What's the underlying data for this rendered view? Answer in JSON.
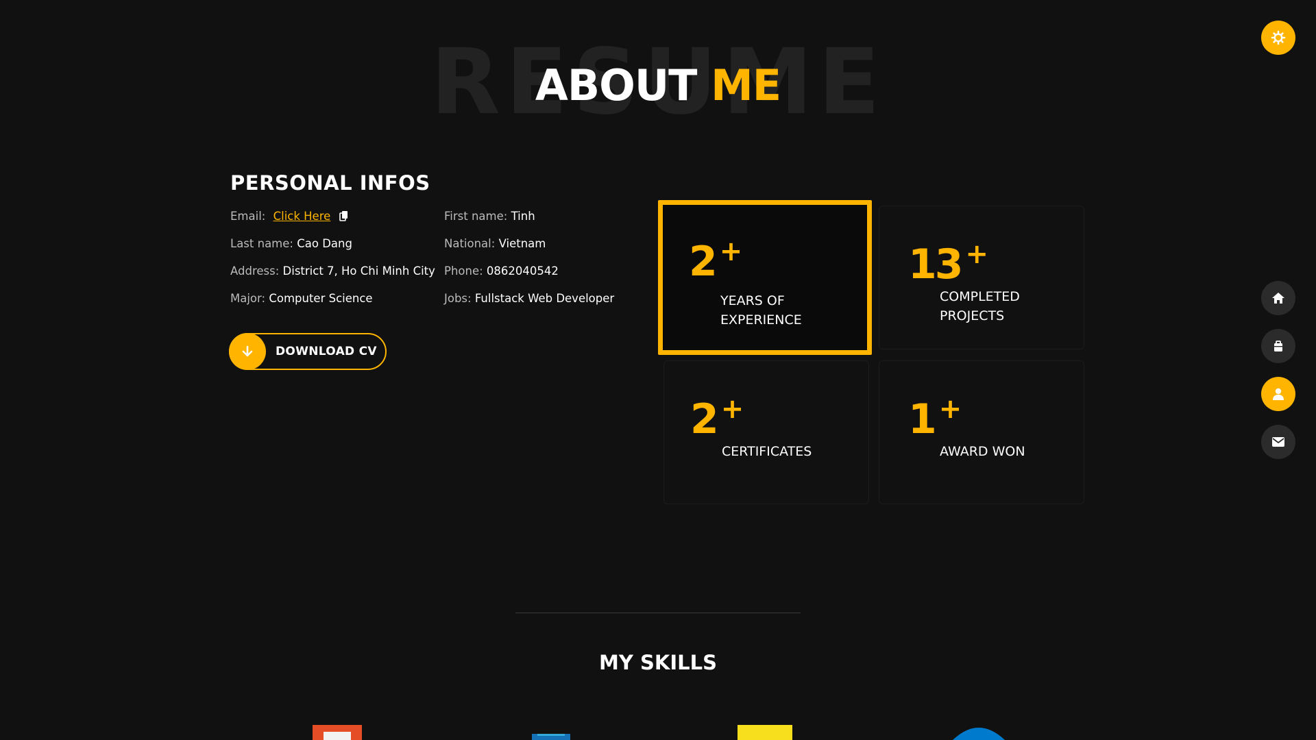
{
  "title": {
    "ghost": "RESUME",
    "main_white": "ABOUT",
    "main_accent": "ME"
  },
  "personal_infos": {
    "heading": "PERSONAL INFOS",
    "left": [
      {
        "label": "Email:",
        "value": "Click Here",
        "type": "link"
      },
      {
        "label": "Last name:",
        "value": "Cao Dang"
      },
      {
        "label": "Address:",
        "value": "District 7, Ho Chi Minh City"
      },
      {
        "label": "Major:",
        "value": "Computer Science"
      }
    ],
    "right": [
      {
        "label": "First name:",
        "value": "Tinh"
      },
      {
        "label": "National:",
        "value": "Vietnam"
      },
      {
        "label": "Phone:",
        "value": "0862040542"
      },
      {
        "label": "Jobs:",
        "value": "Fullstack Web Developer"
      }
    ],
    "download_label": "DOWNLOAD CV"
  },
  "stats": [
    {
      "number": "2",
      "plus": "+",
      "label_line1": "YEARS OF",
      "label_line2": "EXPERIENCE"
    },
    {
      "number": "13",
      "plus": "+",
      "label_line1": "COMPLETED",
      "label_line2": "PROJECTS"
    },
    {
      "number": "2",
      "plus": "+",
      "label_line1": "CERTIFICATES",
      "label_line2": ""
    },
    {
      "number": "1",
      "plus": "+",
      "label_line1": "AWARD WON",
      "label_line2": ""
    }
  ],
  "skills": {
    "heading": "MY SKILLS"
  },
  "nav": {
    "theme_icon": "gear-icon",
    "items": [
      "home-icon",
      "briefcase-icon",
      "user-icon",
      "envelope-icon"
    ],
    "active": "user-icon"
  },
  "colors": {
    "accent": "#ffb400",
    "background": "#111111",
    "nav_inactive": "#2b2b2b"
  }
}
